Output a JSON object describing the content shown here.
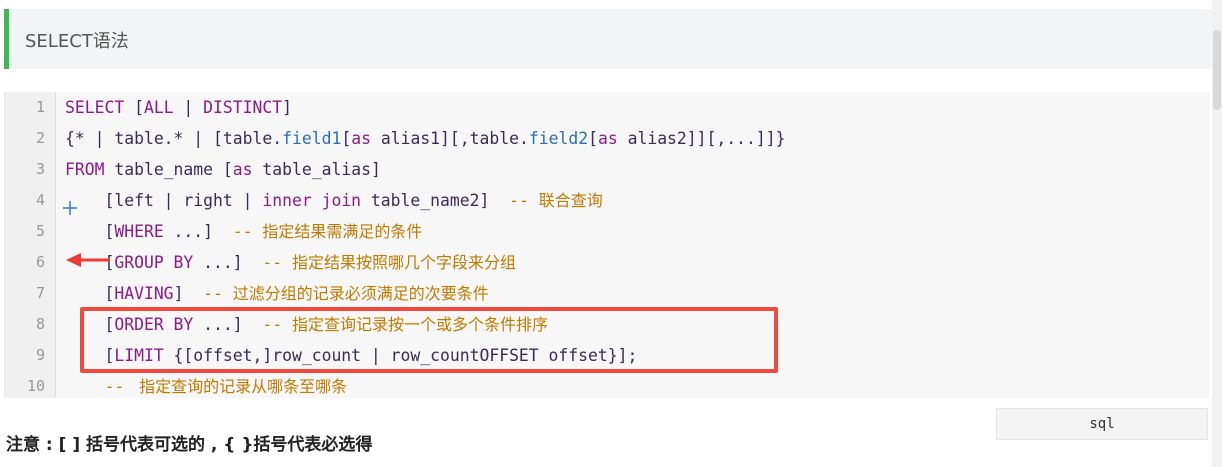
{
  "header": {
    "title": "SELECT语法"
  },
  "code": {
    "language": "sql",
    "lines": [
      {
        "no": "1",
        "parts": [
          {
            "t": "SELECT ",
            "c": "kw"
          },
          {
            "t": "[",
            "c": "ident"
          },
          {
            "t": "ALL",
            "c": "kw"
          },
          {
            "t": " | ",
            "c": "ident"
          },
          {
            "t": "DISTINCT",
            "c": "kw"
          },
          {
            "t": "]",
            "c": "ident"
          }
        ]
      },
      {
        "no": "2",
        "parts": [
          {
            "t": "{* | ",
            "c": "ident"
          },
          {
            "t": "table.*",
            "c": "ident"
          },
          {
            "t": " | [",
            "c": "ident"
          },
          {
            "t": "table",
            "c": "ident"
          },
          {
            "t": ".",
            "c": "ident"
          },
          {
            "t": "field1",
            "c": "prop"
          },
          {
            "t": "[",
            "c": "ident"
          },
          {
            "t": "as",
            "c": "kw"
          },
          {
            "t": " alias1][,",
            "c": "ident"
          },
          {
            "t": "table",
            "c": "ident"
          },
          {
            "t": ".",
            "c": "ident"
          },
          {
            "t": "field2",
            "c": "prop"
          },
          {
            "t": "[",
            "c": "ident"
          },
          {
            "t": "as",
            "c": "kw"
          },
          {
            "t": " alias2]][,...]]}",
            "c": "ident"
          }
        ]
      },
      {
        "no": "3",
        "parts": [
          {
            "t": "FROM",
            "c": "kw"
          },
          {
            "t": " table_name [",
            "c": "ident"
          },
          {
            "t": "as",
            "c": "kw"
          },
          {
            "t": " table_alias]",
            "c": "ident"
          }
        ]
      },
      {
        "no": "4",
        "parts": [
          {
            "t": "    [left | right | ",
            "c": "ident"
          },
          {
            "t": "inner join",
            "c": "kw"
          },
          {
            "t": " table_name2]  ",
            "c": "ident"
          },
          {
            "t": "-- ",
            "c": "cmt"
          },
          {
            "t": "联合查询",
            "c": "cmt zh"
          }
        ]
      },
      {
        "no": "5",
        "parts": [
          {
            "t": "    [",
            "c": "ident"
          },
          {
            "t": "WHERE",
            "c": "kw"
          },
          {
            "t": " ...]  ",
            "c": "ident"
          },
          {
            "t": "-- ",
            "c": "cmt"
          },
          {
            "t": "指定结果需满足的条件",
            "c": "cmt zh"
          }
        ]
      },
      {
        "no": "6",
        "parts": [
          {
            "t": "    [",
            "c": "ident"
          },
          {
            "t": "GROUP BY",
            "c": "kw"
          },
          {
            "t": " ...]  ",
            "c": "ident"
          },
          {
            "t": "-- ",
            "c": "cmt"
          },
          {
            "t": "指定结果按照哪几个字段来分组",
            "c": "cmt zh"
          }
        ]
      },
      {
        "no": "7",
        "parts": [
          {
            "t": "    [",
            "c": "ident"
          },
          {
            "t": "HAVING",
            "c": "kw"
          },
          {
            "t": "]  ",
            "c": "ident"
          },
          {
            "t": "-- ",
            "c": "cmt"
          },
          {
            "t": "过滤分组的记录必须满足的次要条件",
            "c": "cmt zh"
          }
        ]
      },
      {
        "no": "8",
        "parts": [
          {
            "t": "    [",
            "c": "ident"
          },
          {
            "t": "ORDER BY",
            "c": "kw"
          },
          {
            "t": " ...]  ",
            "c": "ident"
          },
          {
            "t": "-- ",
            "c": "cmt"
          },
          {
            "t": "指定查询记录按一个或多个条件排序",
            "c": "cmt zh"
          }
        ]
      },
      {
        "no": "9",
        "parts": [
          {
            "t": "    [",
            "c": "ident"
          },
          {
            "t": "LIMIT",
            "c": "kw"
          },
          {
            "t": " {[offset,]row_count | row_countOFFSET offset}];",
            "c": "ident"
          }
        ]
      },
      {
        "no": "10",
        "parts": [
          {
            "t": "    -- ",
            "c": "cmt"
          },
          {
            "t": " 指定查询的记录从哪条至哪条",
            "c": "cmt zh"
          }
        ]
      }
    ]
  },
  "note": {
    "text": "注意 : [ ] 括号代表可选的 , { }括号代表必选得"
  },
  "colors": {
    "accent": "#3cba4d",
    "highlight": "#ef4b3c"
  }
}
